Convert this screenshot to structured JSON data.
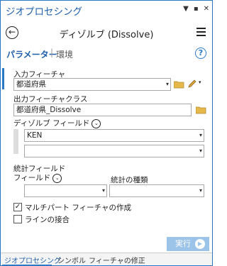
{
  "titlebar": {
    "title": "ジオプロセシング"
  },
  "header": {
    "tool_title": "ディゾルブ (Dissolve)"
  },
  "tabs": {
    "parameters": "パラメーター",
    "separator": "|",
    "environments": "環境"
  },
  "params": {
    "input_label": "入力フィーチャ",
    "input_value": "都道府県",
    "output_label": "出力フィーチャクラス",
    "output_value": "都道府県_Dissolve",
    "dissolve_label": "ディゾルブ フィールド",
    "dissolve_fields": [
      "KEN",
      ""
    ],
    "stats_label": "統計フィールド",
    "field_label": "フィールド",
    "stat_type_label": "統計の種類",
    "field_value": "",
    "stat_type_value": ""
  },
  "options": {
    "multipart_label": "マルチパート フィーチャの作成",
    "multipart_checked": true,
    "unsplit_label": "ラインの接合",
    "unsplit_checked": false
  },
  "run": {
    "label": "実行"
  },
  "bottom_tabs": [
    "ジオプロセシング",
    "シンボル",
    "フィーチャの修正"
  ],
  "colors": {
    "accent": "#2a78c6",
    "run_button": "#9cc3e8"
  }
}
